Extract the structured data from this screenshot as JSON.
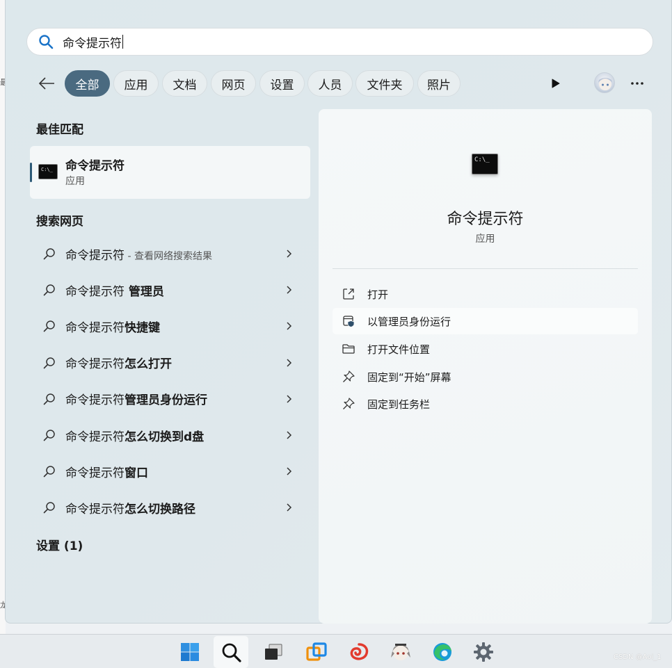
{
  "backdrop": {
    "edge_chars": [
      "最",
      "龙"
    ]
  },
  "search": {
    "value": "命令提示符"
  },
  "filters": {
    "chips": [
      "全部",
      "应用",
      "文档",
      "网页",
      "设置",
      "人员",
      "文件夹",
      "照片"
    ],
    "active_index": 0
  },
  "best_match": {
    "heading": "最佳匹配",
    "title": "命令提示符",
    "type": "应用"
  },
  "web_search": {
    "heading": "搜索网页",
    "items": [
      {
        "prefix": "命令提示符",
        "suffix": "",
        "hint": " - 查看网络搜索结果"
      },
      {
        "prefix": "命令提示符",
        "suffix": " 管理员",
        "hint": ""
      },
      {
        "prefix": "命令提示符",
        "suffix": "快捷键",
        "hint": ""
      },
      {
        "prefix": "命令提示符",
        "suffix": "怎么打开",
        "hint": ""
      },
      {
        "prefix": "命令提示符",
        "suffix": "管理员身份运行",
        "hint": ""
      },
      {
        "prefix": "命令提示符",
        "suffix": "怎么切换到d盘",
        "hint": ""
      },
      {
        "prefix": "命令提示符",
        "suffix": "窗口",
        "hint": ""
      },
      {
        "prefix": "命令提示符",
        "suffix": "怎么切换路径",
        "hint": ""
      }
    ]
  },
  "settings_section": {
    "heading": "设置 (1)"
  },
  "detail": {
    "title": "命令提示符",
    "subtitle": "应用",
    "icon_prompt": "C:\\_",
    "actions": [
      {
        "label": "打开",
        "icon": "open-external-icon"
      },
      {
        "label": "以管理员身份运行",
        "icon": "run-as-admin-shield-icon"
      },
      {
        "label": "打开文件位置",
        "icon": "folder-icon"
      },
      {
        "label": "固定到“开始”屏幕",
        "icon": "pin-icon"
      },
      {
        "label": "固定到任务栏",
        "icon": "pin-icon"
      }
    ]
  },
  "taskbar": {
    "icons": [
      "windows-start-icon",
      "search-icon",
      "task-view-icon",
      "vmware-icon",
      "app-shell-icon",
      "anime-avatar-icon",
      "edge-icon",
      "settings-gear-icon"
    ],
    "watermark": "CSDN @Aoi_1"
  },
  "colors": {
    "accent": "#4a6a80",
    "panel": "#dde8ec",
    "pane": "#f3f7f8"
  }
}
